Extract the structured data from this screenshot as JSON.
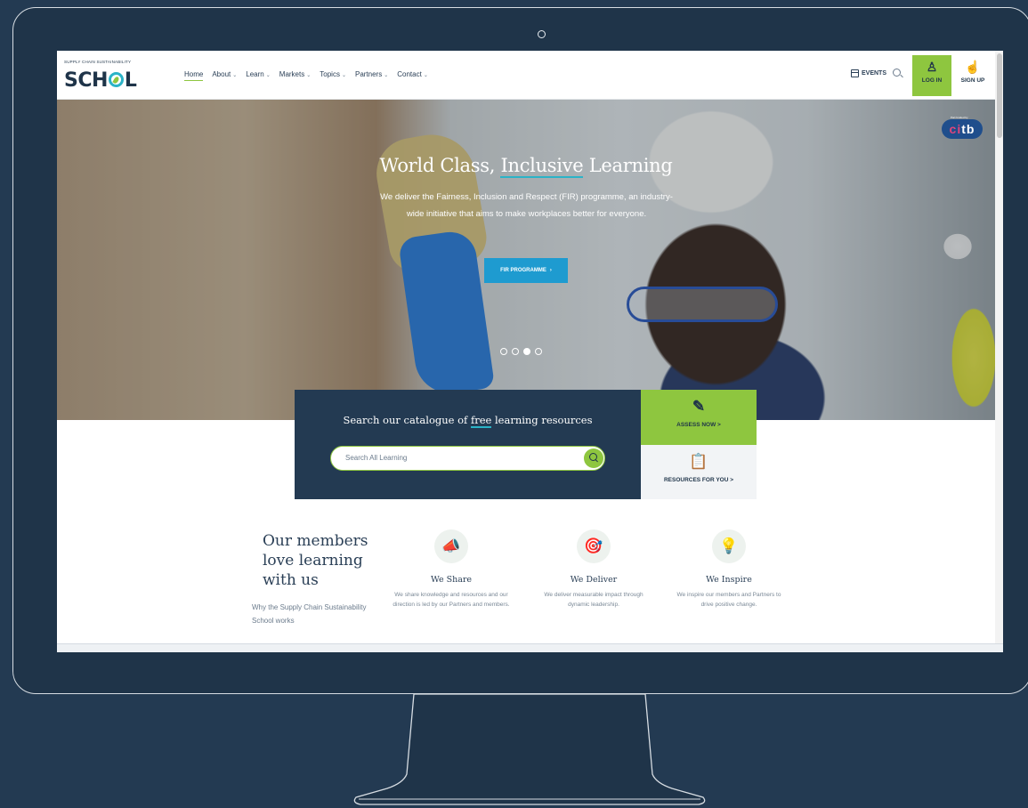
{
  "logo": {
    "top": "SUPPLY CHAIN SUSTAINABILITY",
    "main_left": "SCH",
    "main_right": "L"
  },
  "nav": {
    "items": [
      {
        "label": "Home",
        "dropdown": false
      },
      {
        "label": "About",
        "dropdown": true
      },
      {
        "label": "Learn",
        "dropdown": true
      },
      {
        "label": "Markets",
        "dropdown": true
      },
      {
        "label": "Topics",
        "dropdown": true
      },
      {
        "label": "Partners",
        "dropdown": true
      },
      {
        "label": "Contact",
        "dropdown": true
      }
    ],
    "events_label": "EVENTS",
    "login_label": "LOG IN",
    "signup_label": "SIGN UP"
  },
  "hero": {
    "title_pre": "World Class, ",
    "title_underlined": "Inclusive",
    "title_post": " Learning",
    "subtitle": "We deliver the Fairness, Inclusion and Respect (FIR) programme, an industry-wide initiative that aims to make workplaces better for everyone.",
    "button_label": "FIR PROGRAMME",
    "carousel_dots": 4,
    "active_dot": 2,
    "partner_small": "Part funded by",
    "partner_logo_ci": "ci",
    "partner_logo_tb": "tb"
  },
  "search_panel": {
    "title_pre": "Search our catalogue of ",
    "title_underlined": "free",
    "title_post": " learning resources",
    "placeholder": "Search All Learning"
  },
  "tiles": {
    "assess_label": "ASSESS NOW",
    "resources_label": "RESOURCES FOR YOU",
    "arrow": ">"
  },
  "members": {
    "title": "Our members love learning with us",
    "link": "Why the Supply Chain Sustainability School works"
  },
  "features": [
    {
      "icon": "megaphone-icon",
      "glyph": "📣",
      "title": "We Share",
      "text": "We share knowledge and resources and our direction is led by our Partners and members."
    },
    {
      "icon": "target-icon",
      "glyph": "🎯",
      "title": "We Deliver",
      "text": "We deliver measurable impact through dynamic leadership."
    },
    {
      "icon": "lightbulb-icon",
      "glyph": "💡",
      "title": "We Inspire",
      "text": "We inspire our members and Partners to drive positive change."
    }
  ],
  "colors": {
    "navy": "#233a52",
    "green": "#8ec63f",
    "teal": "#2bb3c7",
    "blue_button": "#1e9bd0"
  }
}
